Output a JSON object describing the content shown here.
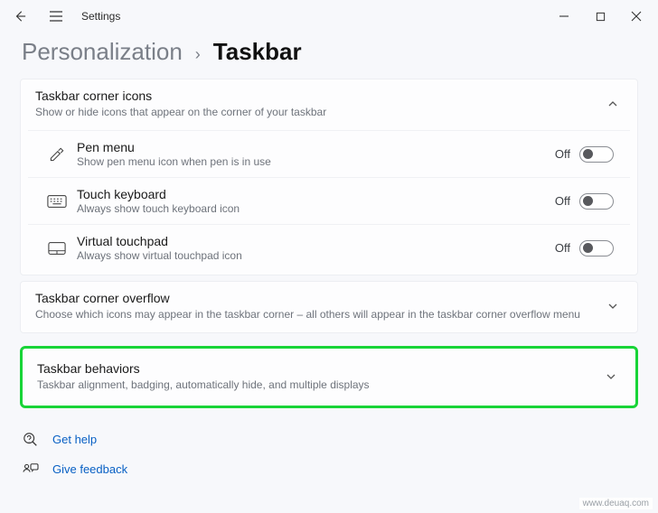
{
  "titlebar": {
    "title": "Settings"
  },
  "breadcrumb": {
    "parent": "Personalization",
    "separator": "›",
    "current": "Taskbar"
  },
  "cornerIcons": {
    "title": "Taskbar corner icons",
    "subtitle": "Show or hide icons that appear on the corner of your taskbar",
    "items": [
      {
        "title": "Pen menu",
        "subtitle": "Show pen menu icon when pen is in use",
        "state": "Off"
      },
      {
        "title": "Touch keyboard",
        "subtitle": "Always show touch keyboard icon",
        "state": "Off"
      },
      {
        "title": "Virtual touchpad",
        "subtitle": "Always show virtual touchpad icon",
        "state": "Off"
      }
    ]
  },
  "overflow": {
    "title": "Taskbar corner overflow",
    "subtitle": "Choose which icons may appear in the taskbar corner – all others will appear in the taskbar corner overflow menu"
  },
  "behaviors": {
    "title": "Taskbar behaviors",
    "subtitle": "Taskbar alignment, badging, automatically hide, and multiple displays"
  },
  "footer": {
    "help": "Get help",
    "feedback": "Give feedback"
  },
  "watermark": "www.deuaq.com"
}
